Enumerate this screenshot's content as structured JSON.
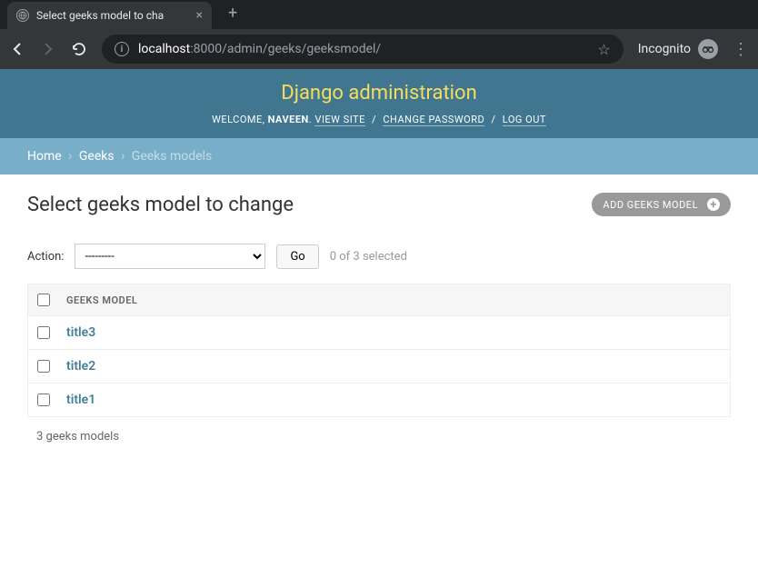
{
  "browser": {
    "tab_title": "Select geeks model to cha",
    "url_host": "localhost",
    "url_path": ":8000/admin/geeks/geeksmodel/",
    "incognito_label": "Incognito"
  },
  "header": {
    "site_title": "Django administration",
    "welcome": "WELCOME,",
    "username": "NAVEEN",
    "view_site": "VIEW SITE",
    "change_password": "CHANGE PASSWORD",
    "logout": "LOG OUT"
  },
  "breadcrumbs": {
    "home": "Home",
    "app": "Geeks",
    "current": "Geeks models"
  },
  "content": {
    "title": "Select geeks model to change",
    "add_button": "ADD GEEKS MODEL",
    "action_label": "Action:",
    "action_placeholder": "---------",
    "go": "Go",
    "selection_count": "0 of 3 selected",
    "column_header": "GEEKS MODEL",
    "rows": [
      {
        "title": "title3"
      },
      {
        "title": "title2"
      },
      {
        "title": "title1"
      }
    ],
    "paginator": "3 geeks models"
  }
}
